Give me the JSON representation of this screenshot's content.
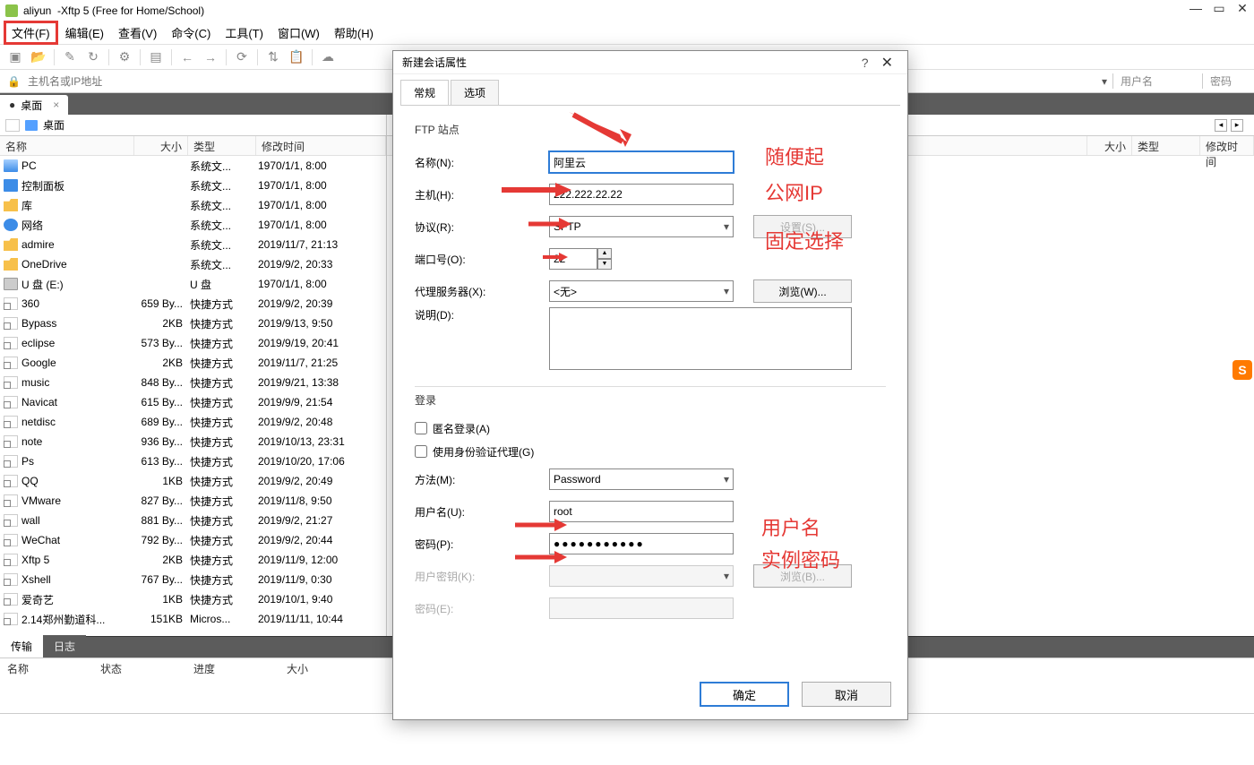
{
  "title": {
    "session": "aliyun",
    "app": "Xftp 5 (Free for Home/School)"
  },
  "menu": [
    "文件(F)",
    "编辑(E)",
    "查看(V)",
    "命令(C)",
    "工具(T)",
    "窗口(W)",
    "帮助(H)"
  ],
  "addr": {
    "placeholder": "主机名或IP地址",
    "user_label": "用户名",
    "pwd_label": "密码"
  },
  "tab": {
    "label": "桌面"
  },
  "pane": {
    "path": "桌面"
  },
  "columns": {
    "name": "名称",
    "size": "大小",
    "type": "类型",
    "mtime": "修改时间"
  },
  "files": [
    {
      "ic": "pc",
      "name": "PC",
      "size": "",
      "type": "系统文...",
      "mtime": "1970/1/1, 8:00"
    },
    {
      "ic": "ctrl",
      "name": "控制面板",
      "size": "",
      "type": "系统文...",
      "mtime": "1970/1/1, 8:00"
    },
    {
      "ic": "folder",
      "name": "库",
      "size": "",
      "type": "系统文...",
      "mtime": "1970/1/1, 8:00"
    },
    {
      "ic": "net",
      "name": "网络",
      "size": "",
      "type": "系统文...",
      "mtime": "1970/1/1, 8:00"
    },
    {
      "ic": "folder",
      "name": "admire",
      "size": "",
      "type": "系统文...",
      "mtime": "2019/11/7, 21:13"
    },
    {
      "ic": "folder",
      "name": "OneDrive",
      "size": "",
      "type": "系统文...",
      "mtime": "2019/9/2, 20:33"
    },
    {
      "ic": "drive",
      "name": "U 盘 (E:)",
      "size": "",
      "type": "U 盘",
      "mtime": "1970/1/1, 8:00"
    },
    {
      "ic": "lnk",
      "name": "360",
      "size": "659 By...",
      "type": "快捷方式",
      "mtime": "2019/9/2, 20:39"
    },
    {
      "ic": "lnk",
      "name": "Bypass",
      "size": "2KB",
      "type": "快捷方式",
      "mtime": "2019/9/13, 9:50"
    },
    {
      "ic": "lnk",
      "name": "eclipse",
      "size": "573 By...",
      "type": "快捷方式",
      "mtime": "2019/9/19, 20:41"
    },
    {
      "ic": "lnk",
      "name": "Google",
      "size": "2KB",
      "type": "快捷方式",
      "mtime": "2019/11/7, 21:25"
    },
    {
      "ic": "lnk",
      "name": "music",
      "size": "848 By...",
      "type": "快捷方式",
      "mtime": "2019/9/21, 13:38"
    },
    {
      "ic": "lnk",
      "name": "Navicat",
      "size": "615 By...",
      "type": "快捷方式",
      "mtime": "2019/9/9, 21:54"
    },
    {
      "ic": "lnk",
      "name": "netdisc",
      "size": "689 By...",
      "type": "快捷方式",
      "mtime": "2019/9/2, 20:48"
    },
    {
      "ic": "lnk",
      "name": "note",
      "size": "936 By...",
      "type": "快捷方式",
      "mtime": "2019/10/13, 23:31"
    },
    {
      "ic": "lnk",
      "name": "Ps",
      "size": "613 By...",
      "type": "快捷方式",
      "mtime": "2019/10/20, 17:06"
    },
    {
      "ic": "lnk",
      "name": "QQ",
      "size": "1KB",
      "type": "快捷方式",
      "mtime": "2019/9/2, 20:49"
    },
    {
      "ic": "lnk",
      "name": "VMware",
      "size": "827 By...",
      "type": "快捷方式",
      "mtime": "2019/11/8, 9:50"
    },
    {
      "ic": "lnk",
      "name": "wall",
      "size": "881 By...",
      "type": "快捷方式",
      "mtime": "2019/9/2, 21:27"
    },
    {
      "ic": "lnk",
      "name": "WeChat",
      "size": "792 By...",
      "type": "快捷方式",
      "mtime": "2019/9/2, 20:44"
    },
    {
      "ic": "lnk",
      "name": "Xftp 5",
      "size": "2KB",
      "type": "快捷方式",
      "mtime": "2019/11/9, 12:00"
    },
    {
      "ic": "lnk",
      "name": "Xshell",
      "size": "767 By...",
      "type": "快捷方式",
      "mtime": "2019/11/9, 0:30"
    },
    {
      "ic": "lnk",
      "name": "爱奇艺",
      "size": "1KB",
      "type": "快捷方式",
      "mtime": "2019/10/1, 9:40"
    },
    {
      "ic": "lnk",
      "name": "2.14郑州勤道科...",
      "size": "151KB",
      "type": "Micros...",
      "mtime": "2019/11/11, 10:44"
    }
  ],
  "bottom": {
    "tab1": "传输",
    "tab2": "日志",
    "c1": "名称",
    "c2": "状态",
    "c3": "进度",
    "c4": "大小"
  },
  "dialog": {
    "title": "新建会话属性",
    "tabs": [
      "常规",
      "选项"
    ],
    "ftp_site": "FTP 站点",
    "name_lbl": "名称(N):",
    "name_val": "阿里云",
    "host_lbl": "主机(H):",
    "host_val": "222.222.22.22",
    "proto_lbl": "协议(R):",
    "proto_val": "SFTP",
    "setup_btn": "设置(S)...",
    "port_lbl": "端口号(O):",
    "port_val": "22",
    "proxy_lbl": "代理服务器(X):",
    "proxy_val": "<无>",
    "browse_btn": "浏览(W)...",
    "desc_lbl": "说明(D):",
    "login": "登录",
    "anon_lbl": "匿名登录(A)",
    "agent_lbl": "使用身份验证代理(G)",
    "method_lbl": "方法(M):",
    "method_val": "Password",
    "user_lbl": "用户名(U):",
    "user_val": "root",
    "pwd_lbl": "密码(P):",
    "pwd_val": "●●●●●●●●●●●",
    "key_lbl": "用户密钥(K):",
    "browse2_btn": "浏览(B)...",
    "pwd2_lbl": "密码(E):",
    "ok": "确定",
    "cancel": "取消"
  },
  "annot": {
    "a1": "随便起",
    "a2": "公网IP",
    "a3": "固定选择",
    "a4": "用户名",
    "a5": "实例密码"
  }
}
